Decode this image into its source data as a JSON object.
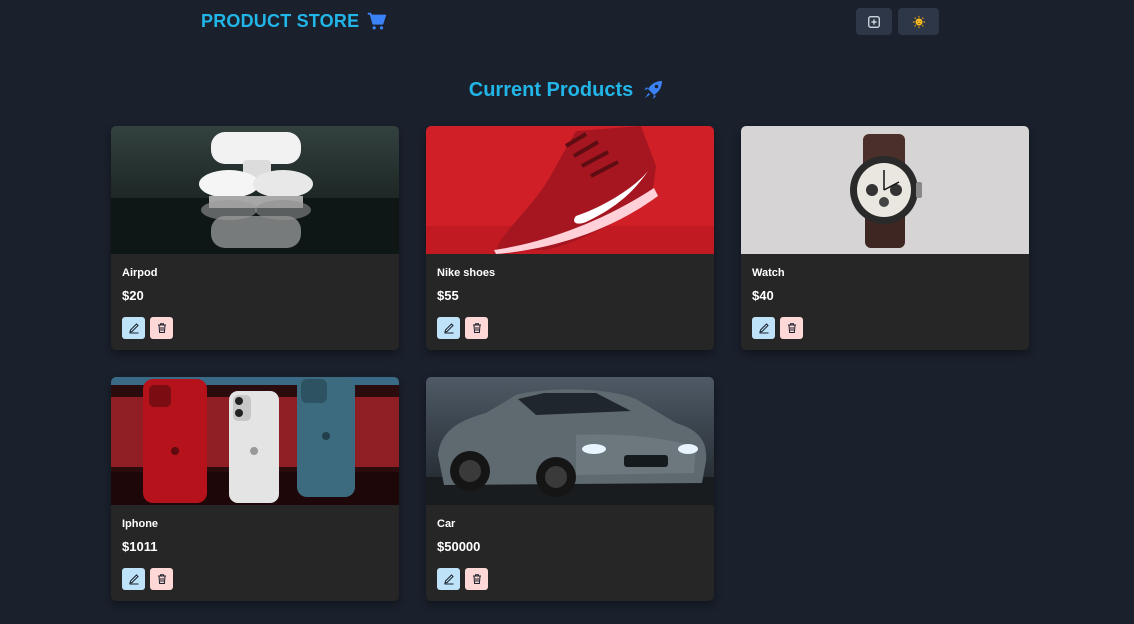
{
  "navbar": {
    "brand": "PRODUCT STORE",
    "brand_icon": "shopping-cart-icon",
    "create_icon": "plus-square-icon",
    "theme_icon": "sun-icon"
  },
  "main": {
    "heading": "Current Products",
    "heading_icon": "rocket-icon"
  },
  "products": [
    {
      "name": "Airpod",
      "price": "$20",
      "image": "airpods-photo"
    },
    {
      "name": "Nike shoes",
      "price": "$55",
      "image": "nike-shoe-photo"
    },
    {
      "name": "Watch",
      "price": "$40",
      "image": "watch-photo"
    },
    {
      "name": "Iphone",
      "price": "$1011",
      "image": "iphones-photo"
    },
    {
      "name": "Car",
      "price": "$50000",
      "image": "car-photo"
    }
  ],
  "colors": {
    "background": "#1a202c",
    "accent": "#22b5e8",
    "card": "#262626",
    "edit_button": "#bee3f8",
    "delete_button": "#fed7d7"
  }
}
